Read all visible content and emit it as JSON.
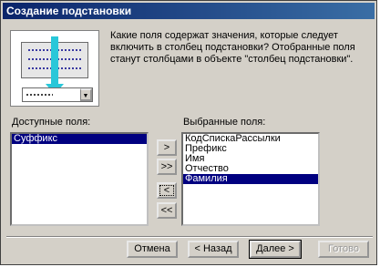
{
  "window": {
    "title": "Создание подстановки"
  },
  "description": "Какие поля содержат значения, которые следует включить в столбец подстановки? Отобранные поля станут столбцами в объекте \"столбец подстановки\".",
  "available": {
    "label": "Доступные поля:",
    "items": [
      "Суффикс"
    ],
    "selected_index": 0
  },
  "chosen": {
    "label": "Выбранные поля:",
    "items": [
      "КодСпискаРассылки",
      "Префикс",
      "Имя",
      "Отчество",
      "Фамилия"
    ],
    "selected_index": 4
  },
  "move_buttons": {
    "one": ">",
    "all": ">>",
    "back_one": "<",
    "back_all": "<<"
  },
  "footer": {
    "cancel": "Отмена",
    "back": "< Назад",
    "next": "Далее >",
    "finish": "Готово"
  }
}
